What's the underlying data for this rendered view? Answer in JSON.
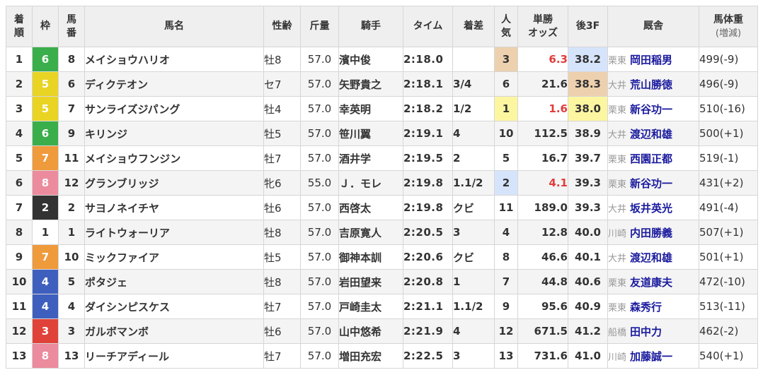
{
  "headers": {
    "rank": [
      "着",
      "順"
    ],
    "waku": "枠",
    "umaban": [
      "馬",
      "番"
    ],
    "name": "馬名",
    "sexage": "性齢",
    "weight": "斤量",
    "jockey": "騎手",
    "time": "タイム",
    "margin": "着差",
    "pop": [
      "人",
      "気"
    ],
    "odds": [
      "単勝",
      "オッズ"
    ],
    "last3f": "後3F",
    "stable": "厩舎",
    "bodyweight": [
      "馬体重",
      "(増減)"
    ]
  },
  "waku_colors": {
    "1": {
      "bg": "#ffffff",
      "fg": "#333333"
    },
    "2": {
      "bg": "#333333",
      "fg": "#ffffff"
    },
    "3": {
      "bg": "#e0423a",
      "fg": "#ffffff"
    },
    "4": {
      "bg": "#3f5fbf",
      "fg": "#ffffff"
    },
    "5": {
      "bg": "#e9d424",
      "fg": "#ffffff"
    },
    "6": {
      "bg": "#3bae4c",
      "fg": "#ffffff"
    },
    "7": {
      "bg": "#ef9a3b",
      "fg": "#ffffff"
    },
    "8": {
      "bg": "#ec8a9e",
      "fg": "#ffffff"
    }
  },
  "highlight_colors": {
    "pop1": "#fdf6a1",
    "pop2": "#d6e4fb",
    "pop3": "#edd1ae",
    "odds_red": "#e23b3b",
    "link": "#1a1a9e"
  },
  "rows": [
    {
      "rank": "1",
      "waku": "6",
      "umaban": "8",
      "name": "メイショウハリオ",
      "sexage": "牡8",
      "weight": "57.0",
      "jockey": "濱中俊",
      "time": "2:18.0",
      "margin": "",
      "pop": "3",
      "odds": "6.3",
      "last3f": "38.2",
      "stable_loc": "栗東",
      "stable": "岡田稲男",
      "bodyweight": "499(-9)",
      "pop_hl": "pop3",
      "odds_red": true,
      "f3_hl": "pop2"
    },
    {
      "rank": "2",
      "waku": "5",
      "umaban": "6",
      "name": "ディクテオン",
      "sexage": "セ7",
      "weight": "57.0",
      "jockey": "矢野貴之",
      "time": "2:18.1",
      "margin": "3/4",
      "pop": "6",
      "odds": "21.6",
      "last3f": "38.3",
      "stable_loc": "大井",
      "stable": "荒山勝徳",
      "bodyweight": "496(-9)",
      "pop_hl": "",
      "odds_red": false,
      "f3_hl": "pop3"
    },
    {
      "rank": "3",
      "waku": "5",
      "umaban": "7",
      "name": "サンライズジパング",
      "sexage": "牡4",
      "weight": "57.0",
      "jockey": "幸英明",
      "time": "2:18.2",
      "margin": "1/2",
      "pop": "1",
      "odds": "1.6",
      "last3f": "38.0",
      "stable_loc": "栗東",
      "stable": "新谷功一",
      "bodyweight": "510(-16)",
      "pop_hl": "pop1",
      "odds_red": true,
      "f3_hl": "pop1"
    },
    {
      "rank": "4",
      "waku": "6",
      "umaban": "9",
      "name": "キリンジ",
      "sexage": "牡5",
      "weight": "57.0",
      "jockey": "笹川翼",
      "time": "2:19.1",
      "margin": "4",
      "pop": "10",
      "odds": "112.5",
      "last3f": "38.9",
      "stable_loc": "大井",
      "stable": "渡辺和雄",
      "bodyweight": "500(+1)",
      "pop_hl": "",
      "odds_red": false,
      "f3_hl": ""
    },
    {
      "rank": "5",
      "waku": "7",
      "umaban": "11",
      "name": "メイショウフンジン",
      "sexage": "牡7",
      "weight": "57.0",
      "jockey": "酒井学",
      "time": "2:19.5",
      "margin": "2",
      "pop": "5",
      "odds": "16.7",
      "last3f": "39.7",
      "stable_loc": "栗東",
      "stable": "西園正都",
      "bodyweight": "519(-1)",
      "pop_hl": "",
      "odds_red": false,
      "f3_hl": ""
    },
    {
      "rank": "6",
      "waku": "8",
      "umaban": "12",
      "name": "グランブリッジ",
      "sexage": "牝6",
      "weight": "55.0",
      "jockey": "Ｊ．モレ",
      "time": "2:19.8",
      "margin": "1.1/2",
      "pop": "2",
      "odds": "4.1",
      "last3f": "39.3",
      "stable_loc": "栗東",
      "stable": "新谷功一",
      "bodyweight": "431(+2)",
      "pop_hl": "pop2",
      "odds_red": true,
      "f3_hl": ""
    },
    {
      "rank": "7",
      "waku": "2",
      "umaban": "2",
      "name": "サヨノネイチヤ",
      "sexage": "牡6",
      "weight": "57.0",
      "jockey": "西啓太",
      "time": "2:19.8",
      "margin": "クビ",
      "pop": "11",
      "odds": "189.0",
      "last3f": "39.3",
      "stable_loc": "大井",
      "stable": "坂井英光",
      "bodyweight": "491(-4)",
      "pop_hl": "",
      "odds_red": false,
      "f3_hl": ""
    },
    {
      "rank": "8",
      "waku": "1",
      "umaban": "1",
      "name": "ライトウォーリア",
      "sexage": "牡8",
      "weight": "57.0",
      "jockey": "吉原寛人",
      "time": "2:20.5",
      "margin": "3",
      "pop": "4",
      "odds": "12.8",
      "last3f": "40.0",
      "stable_loc": "川崎",
      "stable": "内田勝義",
      "bodyweight": "507(+1)",
      "pop_hl": "",
      "odds_red": false,
      "f3_hl": ""
    },
    {
      "rank": "9",
      "waku": "7",
      "umaban": "10",
      "name": "ミックファイア",
      "sexage": "牡5",
      "weight": "57.0",
      "jockey": "御神本訓",
      "time": "2:20.6",
      "margin": "クビ",
      "pop": "8",
      "odds": "46.6",
      "last3f": "40.1",
      "stable_loc": "大井",
      "stable": "渡辺和雄",
      "bodyweight": "501(+1)",
      "pop_hl": "",
      "odds_red": false,
      "f3_hl": ""
    },
    {
      "rank": "10",
      "waku": "4",
      "umaban": "5",
      "name": "ポタジェ",
      "sexage": "牡8",
      "weight": "57.0",
      "jockey": "岩田望来",
      "time": "2:20.8",
      "margin": "1",
      "pop": "7",
      "odds": "44.8",
      "last3f": "40.6",
      "stable_loc": "栗東",
      "stable": "友道康夫",
      "bodyweight": "472(-10)",
      "pop_hl": "",
      "odds_red": false,
      "f3_hl": ""
    },
    {
      "rank": "11",
      "waku": "4",
      "umaban": "4",
      "name": "ダイシンピスケス",
      "sexage": "牡7",
      "weight": "57.0",
      "jockey": "戸崎圭太",
      "time": "2:21.1",
      "margin": "1.1/2",
      "pop": "9",
      "odds": "95.6",
      "last3f": "40.9",
      "stable_loc": "栗東",
      "stable": "森秀行",
      "bodyweight": "513(-11)",
      "pop_hl": "",
      "odds_red": false,
      "f3_hl": ""
    },
    {
      "rank": "12",
      "waku": "3",
      "umaban": "3",
      "name": "ガルボマンボ",
      "sexage": "牡6",
      "weight": "57.0",
      "jockey": "山中悠希",
      "time": "2:21.9",
      "margin": "4",
      "pop": "12",
      "odds": "671.5",
      "last3f": "41.2",
      "stable_loc": "船橋",
      "stable": "田中力",
      "bodyweight": "462(-2)",
      "pop_hl": "",
      "odds_red": false,
      "f3_hl": ""
    },
    {
      "rank": "13",
      "waku": "8",
      "umaban": "13",
      "name": "リーチアディール",
      "sexage": "牡7",
      "weight": "57.0",
      "jockey": "増田充宏",
      "time": "2:22.5",
      "margin": "3",
      "pop": "13",
      "odds": "731.6",
      "last3f": "41.0",
      "stable_loc": "川崎",
      "stable": "加藤誠一",
      "bodyweight": "540(+1)",
      "pop_hl": "",
      "odds_red": false,
      "f3_hl": ""
    }
  ]
}
